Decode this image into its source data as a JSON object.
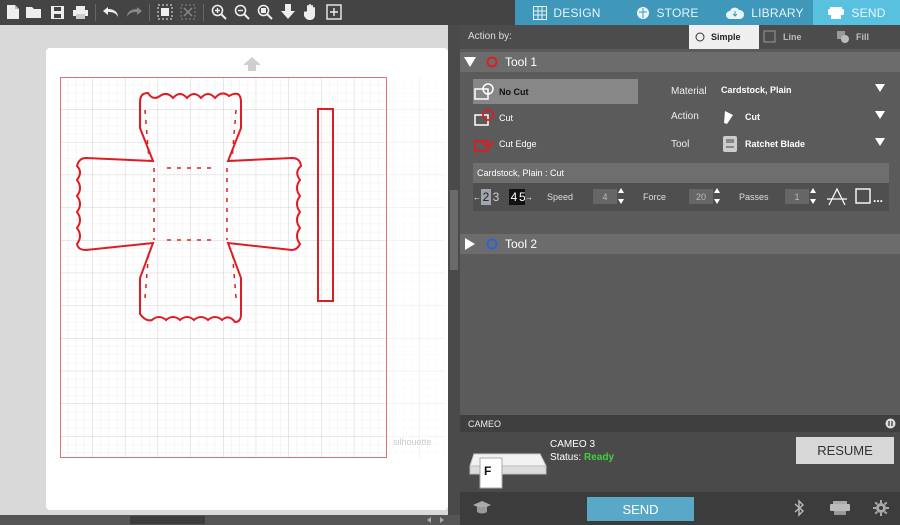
{
  "nav": {
    "design": "DESIGN",
    "store": "STORE",
    "library": "LIBRARY",
    "send": "SEND"
  },
  "canvas": {
    "watermark": "silhouette"
  },
  "action_by": {
    "label": "Action by:",
    "simple": "Simple",
    "line": "Line",
    "fill": "Fill"
  },
  "tool1": {
    "title": "Tool 1",
    "options": [
      {
        "label": "No Cut"
      },
      {
        "label": "Cut"
      },
      {
        "label": "Cut Edge"
      }
    ],
    "material_label": "Material",
    "material_value": "Cardstock, Plain",
    "action_label": "Action",
    "action_value": "Cut",
    "tool_label": "Tool",
    "tool_value": "Ratchet Blade",
    "summary": "Cardstock, Plain : Cut",
    "blade_digits": [
      "2",
      "3",
      "4",
      "5"
    ],
    "speed_label": "Speed",
    "speed_value": "4",
    "force_label": "Force",
    "force_value": "20",
    "passes_label": "Passes",
    "passes_value": "1",
    "more": "..."
  },
  "tool2": {
    "title": "Tool 2"
  },
  "device": {
    "strip_label": "CAMEO",
    "name": "CAMEO 3",
    "status_label": "Status:",
    "status_value": "Ready",
    "thumb_letter": "F"
  },
  "buttons": {
    "send": "SEND",
    "resume": "RESUME"
  },
  "colors": {
    "accent": "#5aa8c7",
    "cut_red": "#e01b24",
    "ready_green": "#3fd23f",
    "tool2_blue": "#2b63d9"
  }
}
